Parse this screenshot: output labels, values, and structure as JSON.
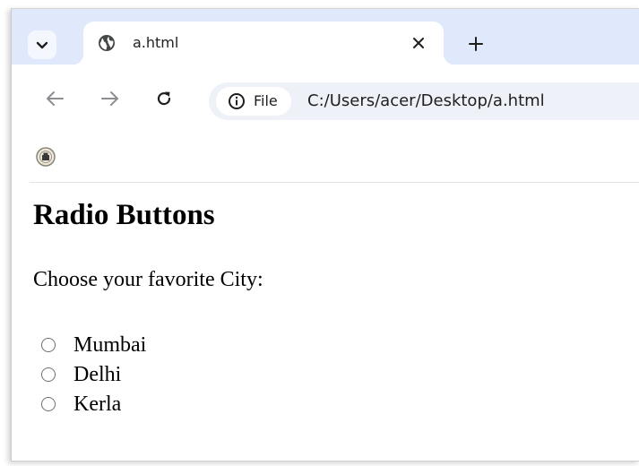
{
  "browser": {
    "tab": {
      "title": "a.html",
      "favicon": "globe-icon"
    },
    "tab_search_icon": "chevron-down-icon",
    "close_icon": "close-icon",
    "new_tab_icon": "plus-icon",
    "back_icon": "arrow-left-icon",
    "forward_icon": "arrow-right-icon",
    "reload_icon": "reload-icon",
    "address": {
      "chip_label": "File",
      "chip_icon": "info-icon",
      "url": "C:/Users/acer/Desktop/a.html"
    },
    "bookmark_icon": "site-favicon-icon"
  },
  "page": {
    "heading": "Radio Buttons",
    "prompt": "Choose your favorite City:",
    "options": [
      {
        "label": "Mumbai",
        "checked": false
      },
      {
        "label": "Delhi",
        "checked": false
      },
      {
        "label": "Kerla",
        "checked": false
      }
    ]
  },
  "colors": {
    "tabstrip_bg": "#dfe9fb",
    "omnibox_bg": "#eef1f8",
    "text": "#1f1f1f"
  }
}
